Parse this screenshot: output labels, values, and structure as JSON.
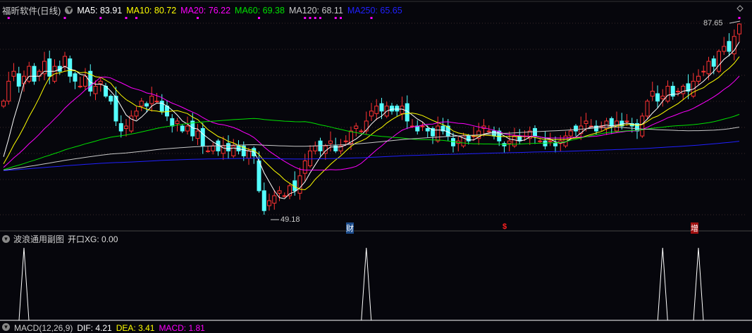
{
  "header": {
    "title": "福昕软件(日线)",
    "ma": [
      {
        "label": "MA5: 83.91",
        "color": "#ffffff"
      },
      {
        "label": "MA10: 80.72",
        "color": "#ffff00"
      },
      {
        "label": "MA20: 76.22",
        "color": "#ff00ff"
      },
      {
        "label": "MA60: 69.38",
        "color": "#00e000"
      },
      {
        "label": "MA120: 68.11",
        "color": "#c8c8c8"
      },
      {
        "label": "MA250: 65.65",
        "color": "#2020ff"
      }
    ]
  },
  "price_labels": {
    "high": "87.65",
    "low": "49.18"
  },
  "event_tags": [
    {
      "text": "财",
      "color": "#ffffff",
      "bg": "#1a4a8a"
    },
    {
      "text": "$",
      "color": "#ff2020"
    },
    {
      "text": "增",
      "color": "#ffffff",
      "bg": "#a01010"
    }
  ],
  "sub_chart": {
    "title": "波浪通用副图",
    "value": "开口XG: 0.00"
  },
  "macd": {
    "title": "MACD(12,26,9)",
    "dif": "DIF: 4.21",
    "dea": "DEA: 3.41",
    "macd": "MACD: 1.81"
  },
  "chart_data": {
    "type": "candlestick",
    "high": 87.65,
    "low": 49.18,
    "history_level": 58,
    "closes": [
      72,
      76,
      78,
      75,
      77,
      79,
      76,
      78,
      80,
      77,
      79,
      78,
      81,
      77,
      76,
      75,
      77,
      74,
      75,
      76,
      73,
      72,
      68,
      66,
      67,
      69,
      70,
      72,
      71,
      73,
      72,
      70,
      69,
      67,
      68,
      66,
      67,
      65,
      66,
      63,
      62,
      63,
      62,
      63,
      62,
      63,
      62,
      61,
      62,
      61,
      54,
      50,
      52,
      53,
      54,
      53,
      55,
      54,
      57,
      60,
      62,
      63,
      62,
      63,
      64,
      62,
      63,
      64,
      66,
      67,
      66,
      68,
      70,
      71,
      70,
      71,
      70,
      70,
      71,
      68,
      67,
      66,
      67,
      66,
      65,
      67,
      66,
      65,
      63,
      64,
      65,
      64,
      65,
      66,
      67,
      66,
      65,
      64,
      63,
      64,
      65,
      64,
      65,
      66,
      65,
      64,
      63,
      64,
      63,
      64,
      65,
      66,
      66,
      67,
      68,
      67,
      66,
      67,
      68,
      67,
      68,
      67,
      68,
      67,
      66,
      69,
      72,
      74,
      72,
      73,
      75,
      73,
      74,
      75,
      74,
      76,
      77,
      78,
      80,
      79,
      82,
      83,
      82,
      85,
      87.5
    ],
    "marker_indices": [
      1,
      12,
      19,
      24,
      26,
      38,
      50,
      59,
      60,
      61,
      62,
      65,
      66,
      72,
      144
    ],
    "signal_indices": [
      4,
      71,
      129,
      136
    ],
    "ma_windows": [
      5,
      10,
      20,
      60,
      120,
      250
    ]
  }
}
